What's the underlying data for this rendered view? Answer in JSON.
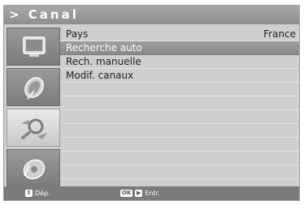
{
  "header": {
    "title": "> Canal"
  },
  "sidebar": {
    "items": [
      {
        "icon": "tv-icon",
        "active": false
      },
      {
        "icon": "satellite-dish-icon",
        "active": false
      },
      {
        "icon": "search-icon",
        "active": true
      },
      {
        "icon": "disc-icon",
        "active": false
      }
    ]
  },
  "menu": {
    "items": [
      {
        "label": "Pays",
        "value": "France",
        "selected": false
      },
      {
        "label": "Recherche auto",
        "value": "",
        "selected": true
      },
      {
        "label": "Rech. manuelle",
        "value": "",
        "selected": false
      },
      {
        "label": "Modif. canaux",
        "value": "",
        "selected": false
      }
    ]
  },
  "footer": {
    "move_label": "Dép.",
    "ok_key": "OK",
    "enter_label": "Entr."
  }
}
